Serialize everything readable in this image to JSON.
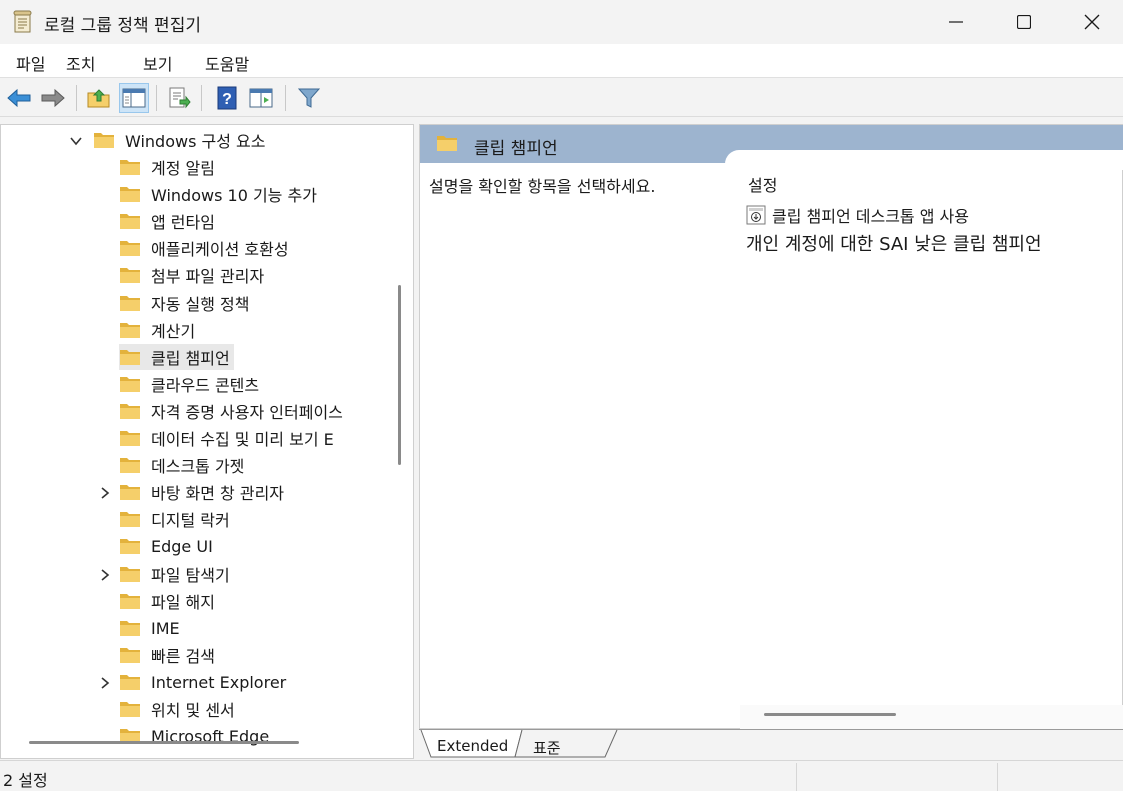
{
  "window": {
    "title": "로컬 그룹 정책 편집기"
  },
  "menu": {
    "items": [
      "파일",
      "조치",
      "보기",
      "도움말"
    ]
  },
  "toolbar": {
    "icons": [
      "back-arrow-icon",
      "forward-arrow-icon",
      "up-folder-icon",
      "show-hide-tree-icon",
      "export-list-icon",
      "help-icon",
      "extended-view-icon",
      "filter-icon"
    ]
  },
  "tree": {
    "parent": "Windows 구성 요소",
    "items": [
      {
        "label": "계정 알림",
        "expandable": false
      },
      {
        "label": "Windows 10 기능 추가",
        "expandable": false
      },
      {
        "label": "앱 런타임",
        "expandable": false
      },
      {
        "label": "애플리케이션 호환성",
        "expandable": false
      },
      {
        "label": "첨부 파일 관리자",
        "expandable": false
      },
      {
        "label": "자동 실행 정책",
        "expandable": false
      },
      {
        "label": "계산기",
        "expandable": false
      },
      {
        "label": "클립 챔피언",
        "expandable": false,
        "selected": true
      },
      {
        "label": "클라우드 콘텐츠",
        "expandable": false
      },
      {
        "label": "자격 증명 사용자 인터페이스",
        "expandable": false
      },
      {
        "label": "데이터 수집 및 미리 보기 E",
        "expandable": false
      },
      {
        "label": "데스크톱 가젯",
        "expandable": false
      },
      {
        "label": "바탕 화면 창 관리자",
        "expandable": true
      },
      {
        "label": "디지털 락커",
        "expandable": false
      },
      {
        "label": "Edge UI",
        "expandable": false
      },
      {
        "label": "파일 탐색기",
        "expandable": true
      },
      {
        "label": "파일 해지",
        "expandable": false
      },
      {
        "label": "IME",
        "expandable": false
      },
      {
        "label": "빠른 검색",
        "expandable": false
      },
      {
        "label": "Internet Explorer",
        "expandable": true
      },
      {
        "label": "위치 및 센서",
        "expandable": false
      },
      {
        "label": "Microsoft Edge",
        "expandable": false
      }
    ]
  },
  "details": {
    "header_title": "클립 챔피언",
    "description_prompt": "설명을 확인할 항목을 선택하세요.",
    "column_header": "설정",
    "setting_name": "클립 챔피언 데스크톱 앱 사용",
    "setting_desc": "개인 계정에 대한 SAI 낮은 클립 챔피언"
  },
  "tabs": {
    "extended": "Extended",
    "standard": "표준"
  },
  "status": {
    "text": "2 설정"
  },
  "colors": {
    "header_band": "#9db4cf",
    "folder_yellow": "#f5cf6a",
    "folder_dark": "#e3b23c",
    "selection_bg": "#e8e8e8"
  }
}
